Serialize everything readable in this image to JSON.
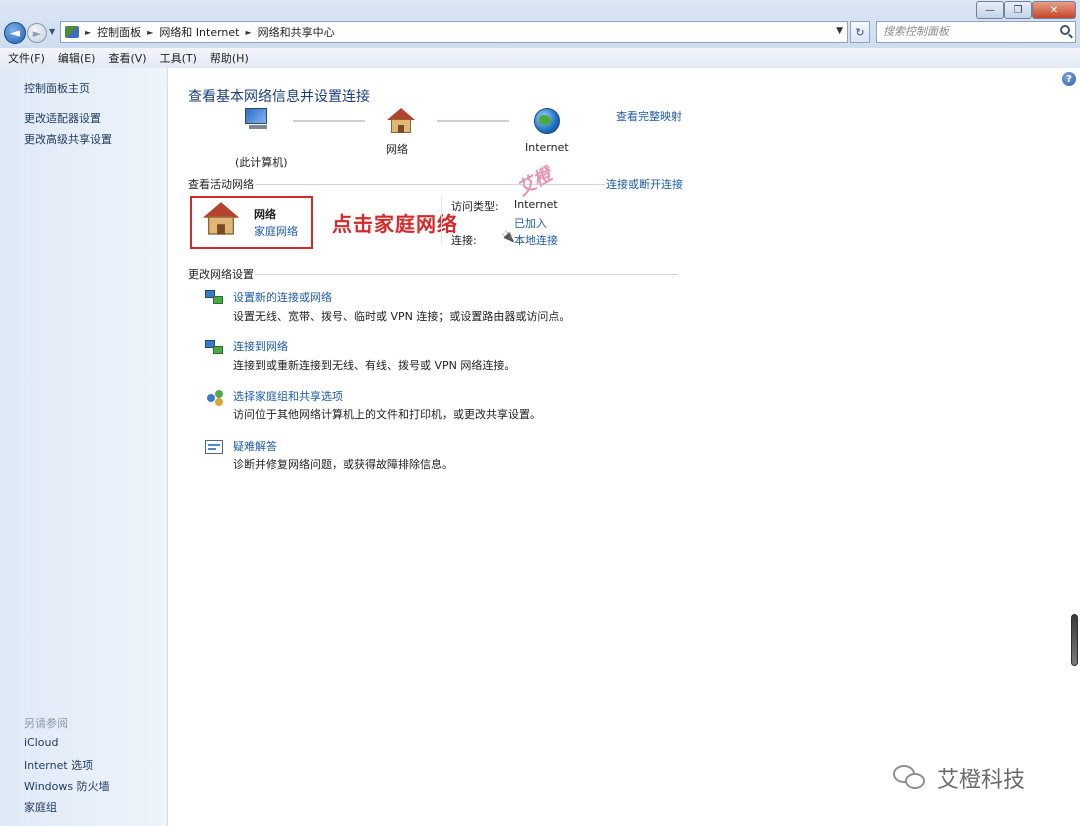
{
  "window": {
    "buttons": {
      "minimize": "—",
      "restore": "❐",
      "close": "✕"
    }
  },
  "nav": {
    "back_glyph": "◄",
    "forward_glyph": "►"
  },
  "address": {
    "crumbs": [
      "控制面板",
      "网络和 Internet",
      "网络和共享中心"
    ],
    "refresh_glyph": "↻"
  },
  "search": {
    "placeholder": "搜索控制面板"
  },
  "menu": [
    "文件(F)",
    "编辑(E)",
    "查看(V)",
    "工具(T)",
    "帮助(H)"
  ],
  "sidebar": {
    "links": [
      "控制面板主页",
      "更改适配器设置",
      "更改高级共享设置"
    ],
    "see_also_heading": "另请参阅",
    "see_also": [
      "iCloud",
      "Internet 选项",
      "Windows 防火墙",
      "家庭组"
    ]
  },
  "main": {
    "help": "?",
    "title": "查看基本网络信息并设置连接",
    "map_link": "查看完整映射",
    "nodes": {
      "computer": "(此计算机)",
      "network": "网络",
      "internet": "Internet"
    },
    "active_section": "查看活动网络",
    "connect_link": "连接或断开连接",
    "network_name": "网络",
    "network_type": "家庭网络",
    "access_type_label": "访问类型:",
    "access_type_value": "Internet",
    "homegroup_value": "已加入",
    "connection_label": "连接:",
    "connection_value": "本地连接",
    "annotation": "点击家庭网络",
    "watermark": "艾橙",
    "change_section": "更改网络设置",
    "tasks": [
      {
        "title": "设置新的连接或网络",
        "desc": "设置无线、宽带、拨号、临时或 VPN 连接；或设置路由器或访问点。"
      },
      {
        "title": "连接到网络",
        "desc": "连接到或重新连接到无线、有线、拨号或 VPN 网络连接。"
      },
      {
        "title": "选择家庭组和共享选项",
        "desc": "访问位于其他网络计算机上的文件和打印机，或更改共享设置。"
      },
      {
        "title": "疑难解答",
        "desc": "诊断并修复网络问题，或获得故障排除信息。"
      }
    ]
  },
  "brand": {
    "text": "艾橙科技"
  }
}
